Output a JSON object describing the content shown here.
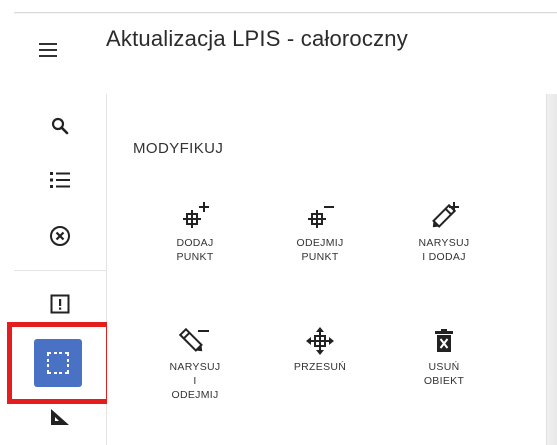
{
  "app": {
    "title": "Aktualizacja LPIS - całoroczny"
  },
  "rail": {
    "items": [
      {
        "icon": "search-icon"
      },
      {
        "icon": "list-icon"
      },
      {
        "icon": "cancel-circle-icon"
      },
      {
        "icon": "warning-box-icon"
      },
      {
        "icon": "select-area-icon",
        "active": true
      },
      {
        "icon": "measure-icon"
      }
    ],
    "active_color": "#4a72c4",
    "highlight_color": "#e41e1e"
  },
  "panel": {
    "section_title": "MODYFIKUJ",
    "tools": [
      {
        "label": "DODAJ\nPUNKT",
        "icon": "add-point-icon"
      },
      {
        "label": "ODEJMIJ\nPUNKT",
        "icon": "remove-point-icon"
      },
      {
        "label": "NARYSUJ\nI DODAJ",
        "icon": "draw-add-icon"
      },
      {
        "label": "NARYSUJ\nI\nODEJMIJ",
        "icon": "draw-subtract-icon"
      },
      {
        "label": "PRZESUŃ",
        "icon": "move-icon"
      },
      {
        "label": "USUŃ\nOBIEKT",
        "icon": "delete-icon"
      }
    ]
  }
}
